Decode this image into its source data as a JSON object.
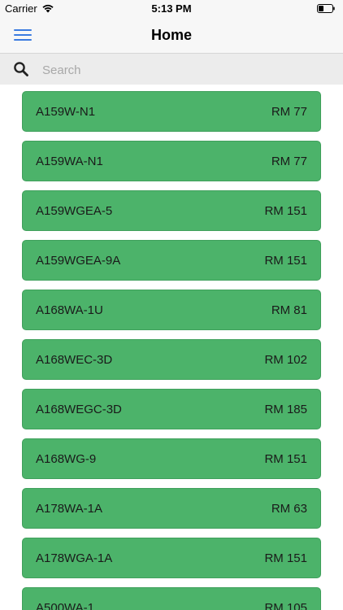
{
  "status_bar": {
    "carrier": "Carrier",
    "time": "5:13 PM"
  },
  "nav": {
    "title": "Home",
    "menu_icon": "hamburger-menu-icon"
  },
  "search": {
    "placeholder": "Search",
    "value": "",
    "icon": "search-icon"
  },
  "theme": {
    "item_background": "#4cb36a",
    "menu_icon_color": "#3b7be0"
  },
  "items": [
    {
      "name": "A159W-N1",
      "price": "RM 77"
    },
    {
      "name": "A159WA-N1",
      "price": "RM 77"
    },
    {
      "name": "A159WGEA-5",
      "price": "RM 151"
    },
    {
      "name": "A159WGEA-9A",
      "price": "RM 151"
    },
    {
      "name": "A168WA-1U",
      "price": "RM 81"
    },
    {
      "name": "A168WEC-3D",
      "price": "RM 102"
    },
    {
      "name": "A168WEGC-3D",
      "price": "RM 185"
    },
    {
      "name": "A168WG-9",
      "price": "RM 151"
    },
    {
      "name": "A178WA-1A",
      "price": "RM 63"
    },
    {
      "name": "A178WGA-1A",
      "price": "RM 151"
    },
    {
      "name": "A500WA-1",
      "price": "RM 105"
    }
  ]
}
